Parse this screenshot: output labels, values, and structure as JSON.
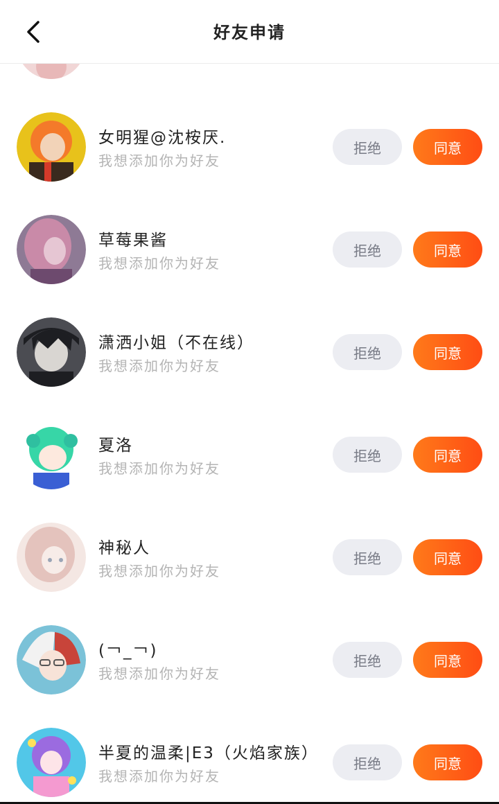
{
  "header": {
    "title": "好友申请",
    "back_icon": "chevron-left-icon"
  },
  "requests": [
    {
      "name": "女明猩@沈桉厌.",
      "message": "我想添加你为好友",
      "reject_label": "拒绝",
      "accept_label": "同意",
      "avatar_colors": [
        "#f47a2a",
        "#3a2a1e",
        "#e8c21b"
      ]
    },
    {
      "name": "草莓果酱",
      "message": "我想添加你为好友",
      "reject_label": "拒绝",
      "accept_label": "同意",
      "avatar_colors": [
        "#c98aa8",
        "#6d4a6e",
        "#e6c6d3"
      ]
    },
    {
      "name": "潇洒小姐（不在线）",
      "message": "我想添加你为好友",
      "reject_label": "拒绝",
      "accept_label": "同意",
      "avatar_colors": [
        "#1d1e22",
        "#d9d6d2",
        "#4b4c52"
      ]
    },
    {
      "name": "夏洛",
      "message": "我想添加你为好友",
      "reject_label": "拒绝",
      "accept_label": "同意",
      "avatar_colors": [
        "#37d6a7",
        "#ffffff",
        "#3a5fd4"
      ]
    },
    {
      "name": "神秘人",
      "message": "我想添加你为好友",
      "reject_label": "拒绝",
      "accept_label": "同意",
      "avatar_colors": [
        "#e4c3bd",
        "#f4e7e3",
        "#9aa5b6"
      ]
    },
    {
      "name": "(￢_￢)",
      "message": "我想添加你为好友",
      "reject_label": "拒绝",
      "accept_label": "同意",
      "avatar_colors": [
        "#f2f2f2",
        "#c8443a",
        "#7bc2d8"
      ]
    },
    {
      "name": "半夏的温柔|E3（火焰家族）",
      "message": "我想添加你为好友",
      "reject_label": "拒绝",
      "accept_label": "同意",
      "avatar_colors": [
        "#9b6be0",
        "#52c7e8",
        "#f49ad0"
      ]
    }
  ],
  "colors": {
    "accent": "#ff5a14",
    "reject_bg": "#ecedf2"
  }
}
